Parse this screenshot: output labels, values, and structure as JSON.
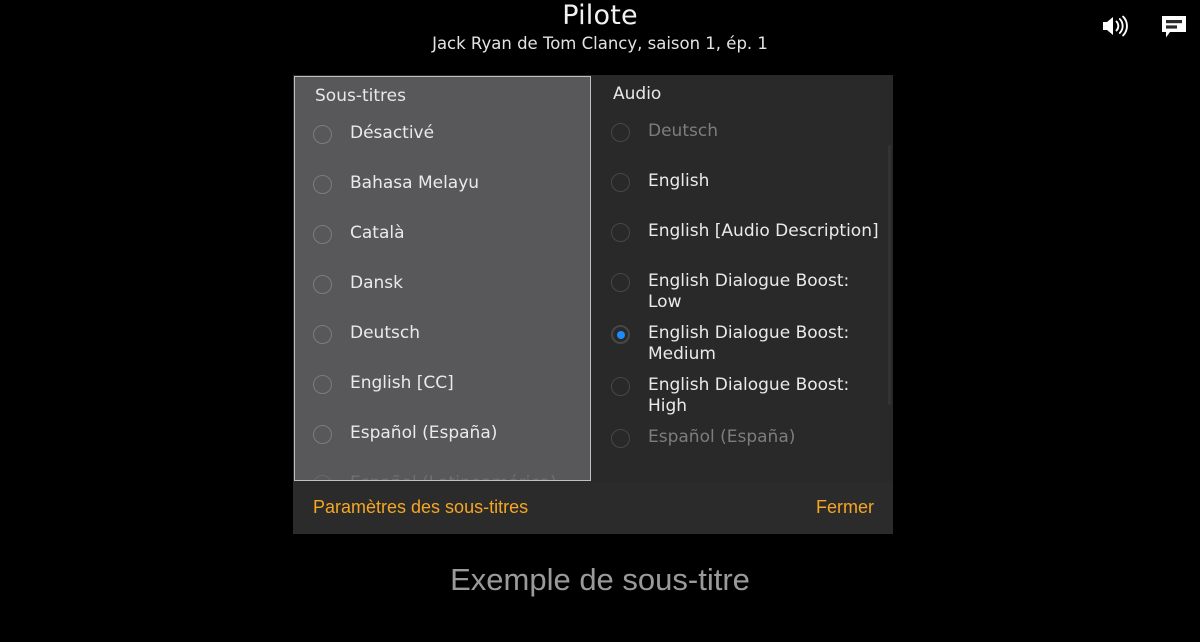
{
  "header": {
    "title": "Pilote",
    "subtitle": "Jack Ryan de Tom Clancy, saison 1, ép. 1",
    "icons": {
      "volume": "volume-icon",
      "subtitles": "subtitles-icon"
    }
  },
  "dialog": {
    "subtitles_panel": {
      "heading": "Sous-titres",
      "options": [
        {
          "label": "Désactivé",
          "selected": false,
          "disabled": false
        },
        {
          "label": "Bahasa Melayu",
          "selected": false,
          "disabled": false
        },
        {
          "label": "Català",
          "selected": false,
          "disabled": false
        },
        {
          "label": "Dansk",
          "selected": false,
          "disabled": false
        },
        {
          "label": "Deutsch",
          "selected": false,
          "disabled": false
        },
        {
          "label": "English [CC]",
          "selected": false,
          "disabled": false
        },
        {
          "label": "Español (España)",
          "selected": false,
          "disabled": false
        },
        {
          "label": "Español (Latinoamérica)",
          "selected": false,
          "disabled": false
        }
      ]
    },
    "audio_panel": {
      "heading": "Audio",
      "options": [
        {
          "label": "Deutsch",
          "selected": false,
          "disabled": true
        },
        {
          "label": "English",
          "selected": false,
          "disabled": false
        },
        {
          "label": "English [Audio Description]",
          "selected": false,
          "disabled": false
        },
        {
          "label": "English Dialogue Boost: Low",
          "selected": false,
          "disabled": false
        },
        {
          "label": "English Dialogue Boost: Medium",
          "selected": true,
          "disabled": false
        },
        {
          "label": "English Dialogue Boost: High",
          "selected": false,
          "disabled": false
        },
        {
          "label": "Español (España)",
          "selected": false,
          "disabled": true
        }
      ]
    },
    "footer": {
      "subtitle_settings_label": "Paramètres des sous-titres",
      "close_label": "Fermer"
    }
  },
  "sample_subtitle": "Exemple de sous-titre",
  "colors": {
    "accent_orange": "#f5a623",
    "selected_blue": "#1a8cff",
    "subtitles_panel_bg": "#58585a",
    "audio_panel_bg": "#292929",
    "footer_bg": "#2b2b2b",
    "page_bg": "#000000"
  }
}
